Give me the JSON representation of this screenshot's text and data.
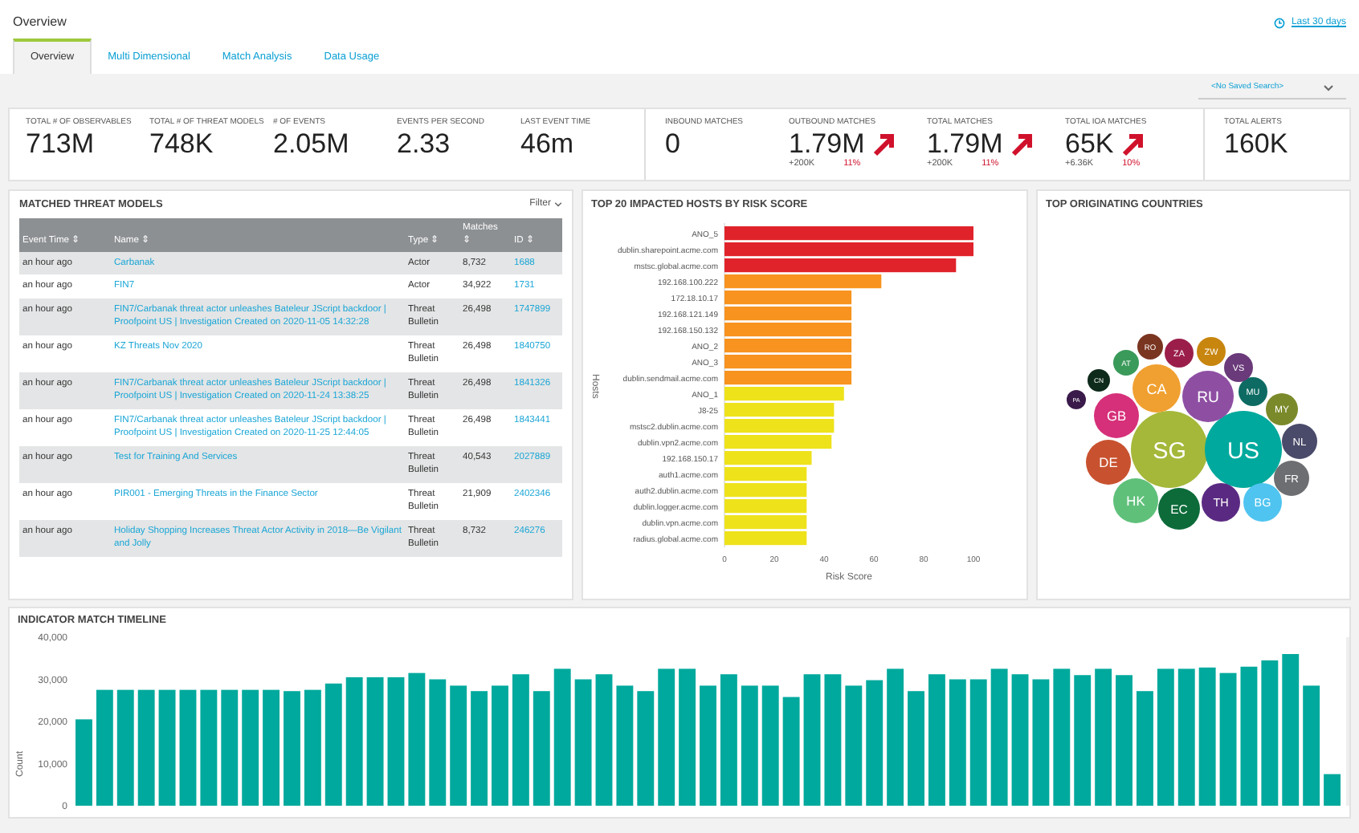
{
  "page": {
    "title": "Overview",
    "date_range": "Last 30 days"
  },
  "tabs": [
    {
      "label": "Overview",
      "selected": true
    },
    {
      "label": "Multi Dimensional",
      "selected": false
    },
    {
      "label": "Match Analysis",
      "selected": false
    },
    {
      "label": "Data Usage",
      "selected": false
    }
  ],
  "saved_search": {
    "value": "<No Saved Search>"
  },
  "kpis": [
    {
      "label": "TOTAL # OF OBSERVABLES",
      "value": "713M"
    },
    {
      "label": "TOTAL # OF THREAT MODELS",
      "value": "748K"
    },
    {
      "label": "# OF EVENTS",
      "value": "2.05M"
    },
    {
      "label": "EVENTS PER SECOND",
      "value": "2.33"
    },
    {
      "label": "LAST EVENT TIME",
      "value": "46m"
    },
    {
      "label": "INBOUND MATCHES",
      "value": "0"
    },
    {
      "label": "OUTBOUND MATCHES",
      "value": "1.79M",
      "delta": "+200K",
      "percent": "11%"
    },
    {
      "label": "TOTAL MATCHES",
      "value": "1.79M",
      "delta": "+200K",
      "percent": "11%"
    },
    {
      "label": "TOTAL IOA MATCHES",
      "value": "65K",
      "delta": "+6.36K",
      "percent": "10%"
    },
    {
      "label": "TOTAL ALERTS",
      "value": "160K"
    }
  ],
  "threat_models": {
    "title": "MATCHED THREAT MODELS",
    "filter": "Filter",
    "columns": [
      "Event Time ⇕",
      "Name ⇕",
      "Type ⇕",
      "Matches ⇕",
      "ID ⇕"
    ],
    "rows": [
      [
        "an hour ago",
        "Carbanak",
        "Actor",
        "8,732",
        "1688"
      ],
      [
        "an hour ago",
        "FIN7",
        "Actor",
        "34,922",
        "1731"
      ],
      [
        "an hour ago",
        "FIN7/Carbanak threat actor unleashes Bateleur JScript backdoor | Proofpoint US | Investigation Created on 2020-11-05 14:32:28",
        "Threat Bulletin",
        "26,498",
        "1747899"
      ],
      [
        "an hour ago",
        "KZ Threats Nov 2020",
        "Threat Bulletin",
        "26,498",
        "1840750"
      ],
      [
        "an hour ago",
        "FIN7/Carbanak threat actor unleashes Bateleur JScript backdoor | Proofpoint US | Investigation Created on 2020-11-24 13:38:25",
        "Threat Bulletin",
        "26,498",
        "1841326"
      ],
      [
        "an hour ago",
        "FIN7/Carbanak threat actor unleashes Bateleur JScript backdoor | Proofpoint US | Investigation Created on 2020-11-25 12:44:05",
        "Threat Bulletin",
        "26,498",
        "1843441"
      ],
      [
        "an hour ago",
        "Test for Training And Services",
        "Threat Bulletin",
        "40,543",
        "2027889"
      ],
      [
        "an hour ago",
        "PIR001 - Emerging Threats in the Finance Sector",
        "Threat Bulletin",
        "21,909",
        "2402346"
      ],
      [
        "an hour ago",
        "Holiday Shopping Increases Threat Actor Activity in 2018—Be Vigilant and Jolly",
        "Threat Bulletin",
        "8,732",
        "246276"
      ]
    ]
  },
  "hosts": {
    "title": "TOP 20 IMPACTED HOSTS BY RISK SCORE",
    "chart_data": {
      "type": "bar",
      "orientation": "horizontal",
      "stacked": true,
      "xlabel": "Risk Score",
      "ylabel": "Hosts",
      "categories": [
        "ANO_5",
        "dublin.sharepoint.acme.com",
        "mstsc.global.acme.com",
        "192.168.100.222",
        "172.18.10.17",
        "192.168.121.149",
        "192.168.150.132",
        "ANO_2",
        "ANO_3",
        "dublin.sendmail.acme.com",
        "ANO_1",
        "J8-25",
        "mstsc2.dublin.acme.com",
        "dublin.vpn2.acme.com",
        "192.168.150.17",
        "auth1.acme.com",
        "auth2.dublin.acme.com",
        "dublin.logger.acme.com",
        "dublin.vpn.acme.com",
        "radius.global.acme.com"
      ],
      "series": [
        {
          "color": "#e0232b",
          "values": [
            100,
            100,
            93,
            null,
            null,
            null,
            null,
            null,
            null,
            null,
            null,
            null,
            null,
            null,
            null,
            null,
            null,
            null,
            null,
            null
          ]
        },
        {
          "color": "#f7931e",
          "values": [
            null,
            null,
            null,
            63,
            51,
            51,
            51,
            51,
            51,
            51,
            null,
            null,
            null,
            null,
            null,
            null,
            null,
            null,
            null,
            null
          ]
        },
        {
          "color": "#eee21b",
          "values": [
            null,
            null,
            null,
            null,
            null,
            null,
            null,
            null,
            null,
            null,
            48,
            44,
            44,
            43,
            35,
            33,
            33,
            33,
            33,
            33
          ]
        }
      ],
      "xlim": [
        0,
        100
      ],
      "xticks": [
        0,
        20,
        40,
        60,
        80,
        100
      ]
    }
  },
  "countries": {
    "title": "TOP ORIGINATING COUNTRIES",
    "items": [
      {
        "code": "SG",
        "color": "#a5b83a"
      },
      {
        "code": "US",
        "color": "#00a99d"
      },
      {
        "code": "RU",
        "color": "#8e4fa3"
      },
      {
        "code": "CA",
        "color": "#f0a030"
      },
      {
        "code": "GB",
        "color": "#d6307a"
      },
      {
        "code": "DE",
        "color": "#c8522f"
      },
      {
        "code": "HK",
        "color": "#5fc07a"
      },
      {
        "code": "EC",
        "color": "#0d6b3a"
      },
      {
        "code": "TH",
        "color": "#5a2a82"
      },
      {
        "code": "BG",
        "color": "#4fc4f0"
      },
      {
        "code": "FR",
        "color": "#6d6e71"
      },
      {
        "code": "NL",
        "color": "#4a4a6a"
      },
      {
        "code": "MY",
        "color": "#7a8a2a"
      },
      {
        "code": "MU",
        "color": "#0d6b63"
      },
      {
        "code": "VS",
        "color": "#6a3a7a"
      },
      {
        "code": "ZA",
        "color": "#9b1e4a"
      },
      {
        "code": "ZW",
        "color": "#c8860f"
      },
      {
        "code": "RO",
        "color": "#7a3520"
      },
      {
        "code": "AT",
        "color": "#3a9a5a"
      },
      {
        "code": "CN",
        "color": "#0d2a1a"
      },
      {
        "code": "PA",
        "color": "#3a1a4a"
      }
    ]
  },
  "timeline": {
    "title": "INDICATOR MATCH TIMELINE",
    "chart_data": {
      "type": "bar",
      "ylabel": "Count",
      "ylim": [
        0,
        40000
      ],
      "yticks": [
        {
          "value": 0,
          "label": "0"
        },
        {
          "value": 10000,
          "label": "10,000"
        },
        {
          "value": 20000,
          "label": "20,000"
        },
        {
          "value": 30000,
          "label": "30,000"
        },
        {
          "value": 40000,
          "label": "40,000"
        }
      ],
      "series": [
        {
          "color": "#00a99d",
          "values": [
            20500,
            27500,
            27500,
            27500,
            27500,
            27500,
            27500,
            27500,
            27500,
            27500,
            27200,
            27500,
            29000,
            30500,
            30500,
            30500,
            31500,
            30000,
            28500,
            27200,
            28500,
            31200,
            27200,
            32500,
            30000,
            31200,
            28500,
            27200,
            32500,
            32500,
            28500,
            31200,
            28500,
            28500,
            25800,
            31200,
            31200,
            28500,
            29800,
            32500,
            27200,
            31200,
            30000,
            30000,
            32500,
            31200,
            30000,
            32500,
            31000,
            32500,
            31000,
            27200,
            32500,
            32500,
            32800,
            31500,
            33000,
            34500,
            36000,
            28500,
            7500
          ]
        }
      ]
    }
  }
}
